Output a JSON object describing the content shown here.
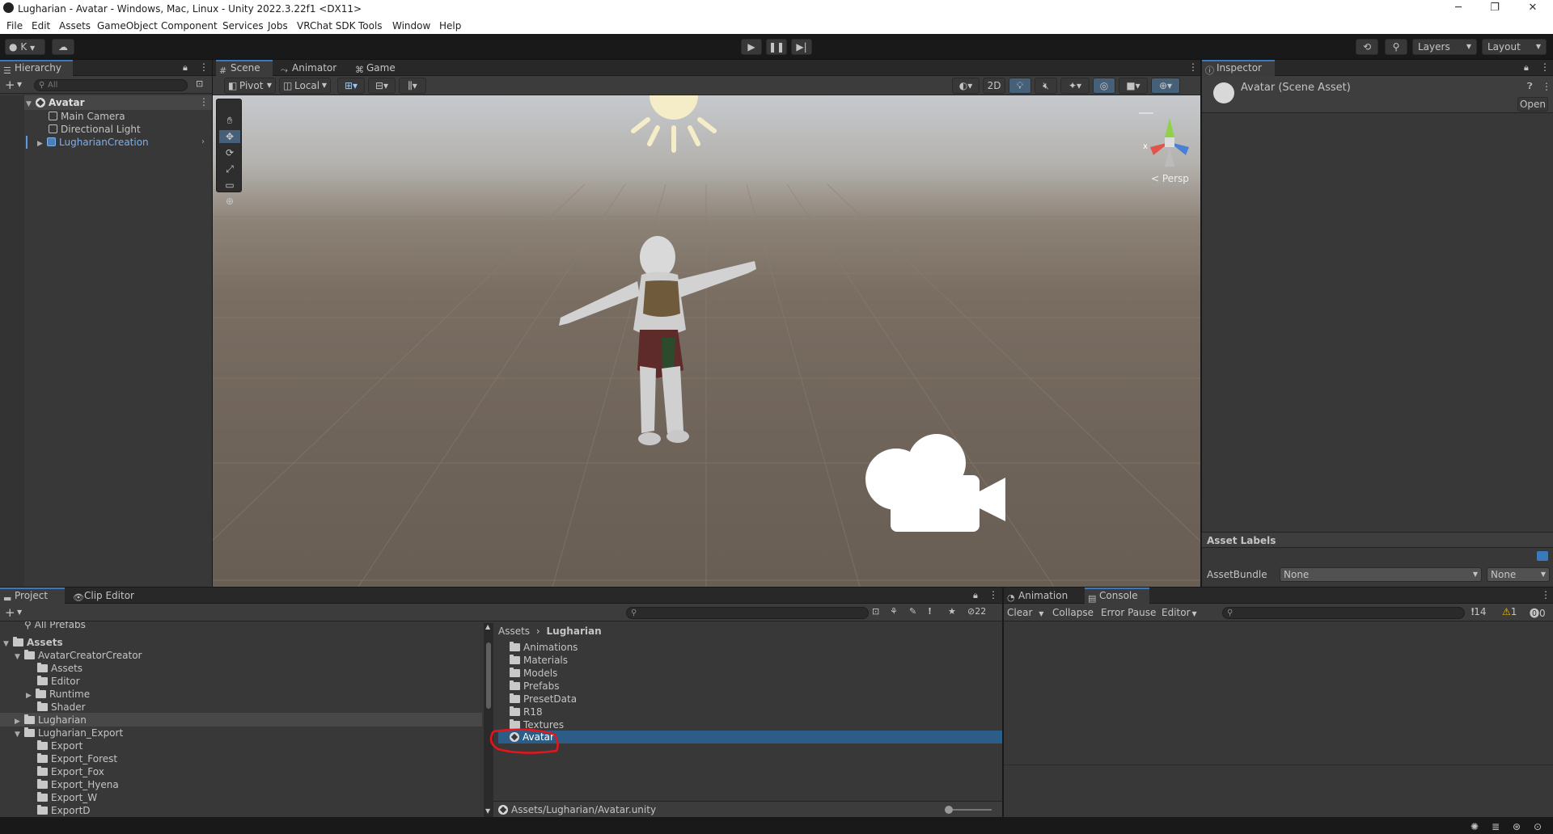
{
  "window": {
    "title": "Lugharian - Avatar - Windows, Mac, Linux - Unity 2022.3.22f1 <DX11>",
    "controls": [
      "─",
      "❐",
      "✕"
    ]
  },
  "menu": [
    "File",
    "Edit",
    "Assets",
    "GameObject",
    "Component",
    "Services",
    "Jobs",
    "VRChat SDK",
    "Tools",
    "Window",
    "Help"
  ],
  "toolbar": {
    "account": "K",
    "layers": "Layers",
    "layout": "Layout"
  },
  "hierarchy": {
    "tab": "Hierarchy",
    "search_placeholder": "All",
    "scene": "Avatar",
    "items": [
      "Main Camera",
      "Directional Light",
      "LugharianCreation"
    ]
  },
  "scene_tabs": [
    "Scene",
    "Animator",
    "Game"
  ],
  "scene_toolbar": {
    "pivot": "Pivot",
    "local": "Local",
    "mode_2d": "2D"
  },
  "scene_view": {
    "projection": "Persp",
    "gizmo_axes": [
      "x",
      "z"
    ]
  },
  "inspector": {
    "tab": "Inspector",
    "title": "Avatar (Scene Asset)",
    "open_button": "Open",
    "asset_labels": "Asset Labels",
    "assetbundle_label": "AssetBundle",
    "assetbundle_value": "None",
    "assetbundle_variant": "None"
  },
  "project": {
    "tabs": [
      "Project",
      "Clip Editor"
    ],
    "hidden_count": "22",
    "favorites_partial": "All Prefabs",
    "tree": {
      "assets": "Assets",
      "avatarcreator": "AvatarCreatorCreator",
      "ac_children": [
        "Assets",
        "Editor",
        "Runtime",
        "Shader"
      ],
      "lugharian": "Lugharian",
      "lugharian_export": "Lugharian_Export",
      "export_children": [
        "Export",
        "Export_Forest",
        "Export_Fox",
        "Export_Hyena",
        "Export_W",
        "ExportD"
      ]
    },
    "breadcrumb": [
      "Assets",
      "Lugharian"
    ],
    "folders": [
      "Animations",
      "Materials",
      "Models",
      "Prefabs",
      "PresetData",
      "R18",
      "Textures"
    ],
    "selected_file": "Avatar",
    "status_path": "Assets/Lugharian/Avatar.unity"
  },
  "console": {
    "tabs": [
      "Animation",
      "Console"
    ],
    "clear": "Clear",
    "collapse": "Collapse",
    "error_pause": "Error Pause",
    "editor": "Editor",
    "info_count": "14",
    "warning_count": "1",
    "error_count": "0"
  },
  "colors": {
    "accent": "#3a79bb",
    "selection": "#2c5d87",
    "highlight_ring": "#e8141b",
    "panel": "#383838"
  }
}
